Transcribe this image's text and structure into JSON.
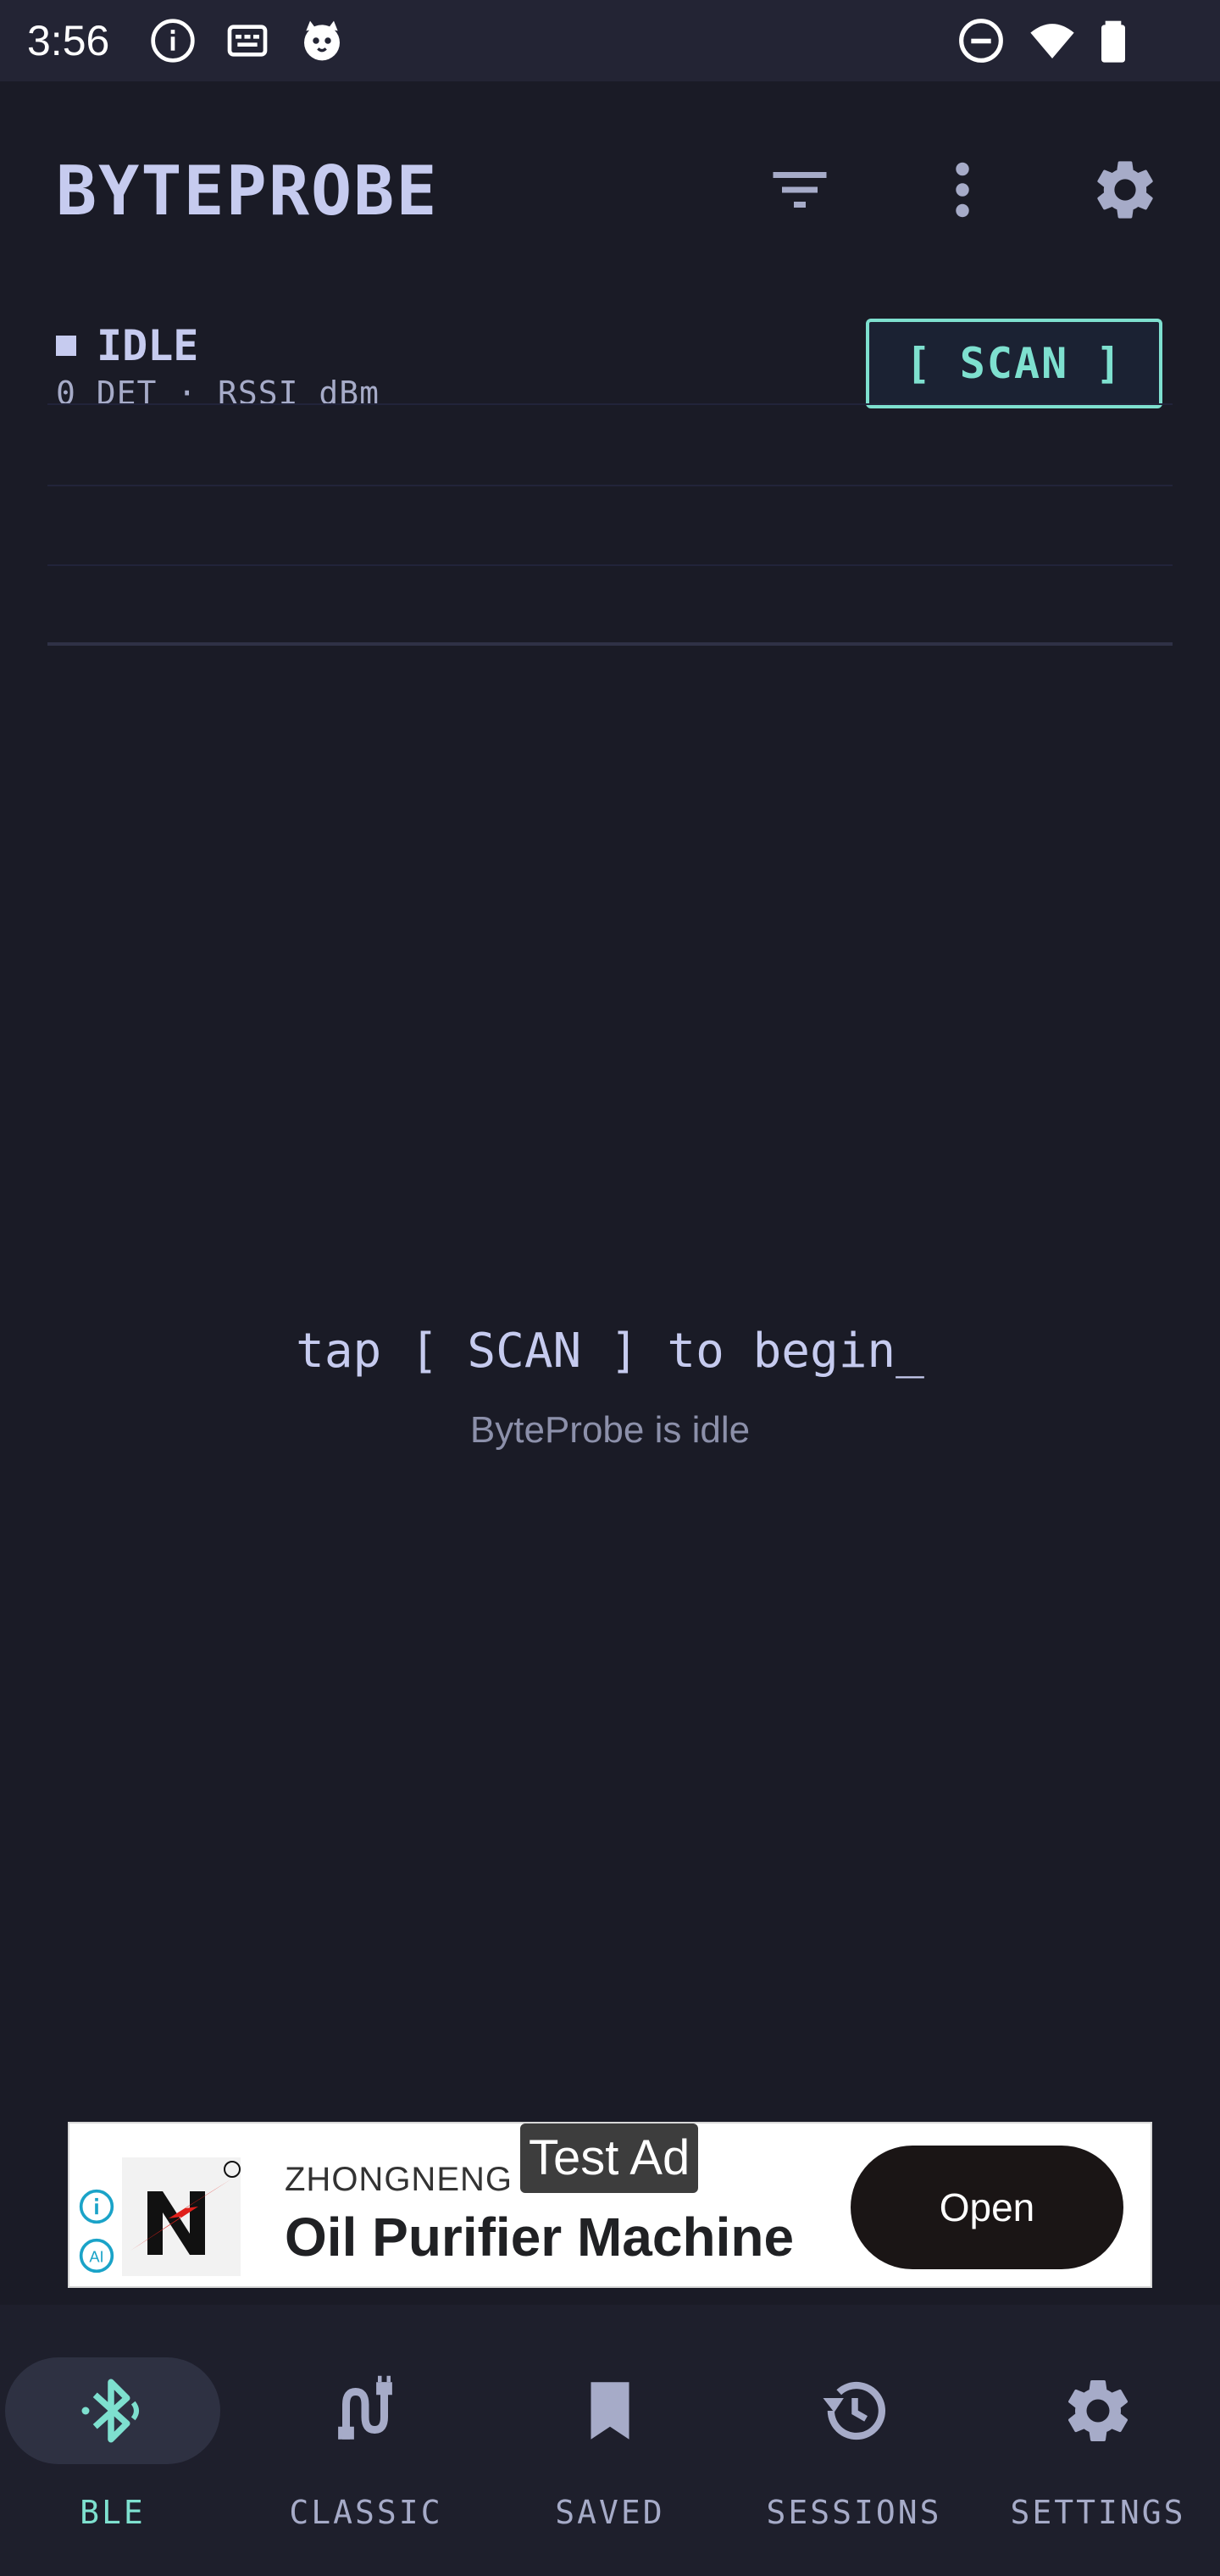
{
  "status_bar": {
    "time": "3:56",
    "left_icons": [
      "info-icon",
      "keyboard-icon",
      "cat-icon"
    ],
    "right_icons": [
      "do-not-disturb-icon",
      "wifi-icon",
      "battery-icon"
    ]
  },
  "app_bar": {
    "title": "BYTEPROBE",
    "actions": [
      "filter-icon",
      "more-vert-icon",
      "gear-icon"
    ]
  },
  "scan_status": {
    "state": "IDLE",
    "meta": "0 DET · RSSI dBm",
    "scan_button_label": "[ SCAN ]"
  },
  "empty_state": {
    "title": "tap [ SCAN ] to begin_",
    "subtitle": "ByteProbe is idle"
  },
  "ad": {
    "brand": "ZHONGNENG O",
    "tag": "Test Ad",
    "headline": "Oil Purifier Machine",
    "cta_label": "Open",
    "info_icon": "info-icon",
    "ai_label": "AI"
  },
  "bottom_nav": {
    "items": [
      {
        "label": "BLE",
        "icon": "bluetooth-icon",
        "active": true
      },
      {
        "label": "CLASSIC",
        "icon": "cable-icon",
        "active": false
      },
      {
        "label": "SAVED",
        "icon": "bookmark-icon",
        "active": false
      },
      {
        "label": "SESSIONS",
        "icon": "history-icon",
        "active": false
      },
      {
        "label": "SETTINGS",
        "icon": "gear-icon",
        "active": false
      }
    ]
  },
  "colors": {
    "background": "#1a1b26",
    "accent": "#7ee0cf",
    "text": "#c6cbef",
    "muted": "#a6abc8"
  }
}
